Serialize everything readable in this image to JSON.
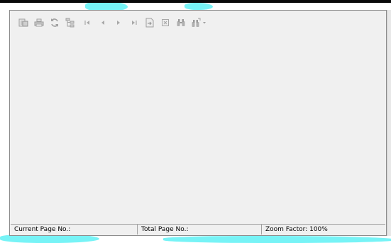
{
  "toolbar": {
    "buttons": [
      {
        "name": "export-icon",
        "tooltip": ""
      },
      {
        "name": "print-icon",
        "tooltip": ""
      },
      {
        "name": "refresh-icon",
        "tooltip": ""
      },
      {
        "name": "group-tree-icon",
        "tooltip": ""
      },
      {
        "name": "first-page-icon",
        "tooltip": ""
      },
      {
        "name": "previous-page-icon",
        "tooltip": ""
      },
      {
        "name": "next-page-icon",
        "tooltip": ""
      },
      {
        "name": "last-page-icon",
        "tooltip": ""
      },
      {
        "name": "goto-page-icon",
        "tooltip": ""
      },
      {
        "name": "close-view-icon",
        "tooltip": ""
      },
      {
        "name": "find-icon",
        "tooltip": ""
      },
      {
        "name": "zoom-icon",
        "tooltip": ""
      }
    ],
    "icon_color": "#a8a8a8"
  },
  "status_bar": {
    "current_page_label": "Current Page No.:",
    "total_page_label": "Total Page No.:",
    "zoom_label": "Zoom Factor: 100%"
  },
  "colors": {
    "viewer_background": "#f0f0f0",
    "border": "#8c8c8c",
    "splash": "#5ff1f5"
  }
}
